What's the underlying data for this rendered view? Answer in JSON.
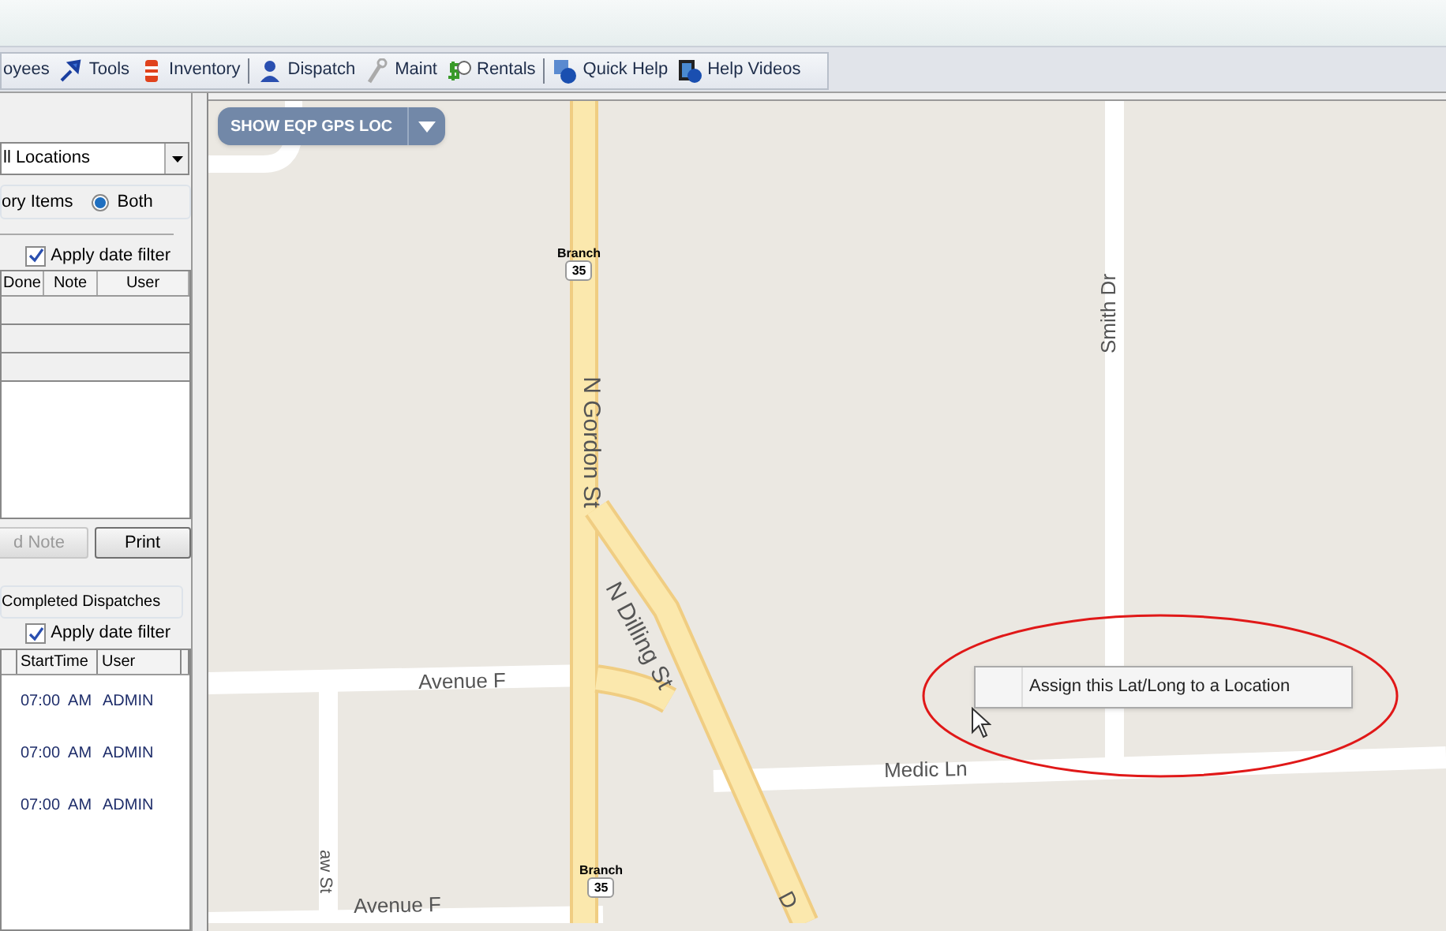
{
  "toolbar": {
    "items": [
      {
        "label": "oyees",
        "separator_before": false
      },
      {
        "label": "Tools",
        "separator_before": false
      },
      {
        "label": "Inventory",
        "separator_before": false
      },
      {
        "label": "Dispatch",
        "separator_before": true
      },
      {
        "label": "Maint",
        "separator_before": false
      },
      {
        "label": "Rentals",
        "separator_before": false
      },
      {
        "label": "Quick Help",
        "separator_before": true
      },
      {
        "label": "Help Videos",
        "separator_before": false
      }
    ]
  },
  "left_panel": {
    "location_select": {
      "value": "ll Locations"
    },
    "item_filter": [
      {
        "label": "ory Items"
      },
      {
        "label": "Both",
        "selected": true
      }
    ],
    "notes_date_filter": {
      "label": "Apply date filter",
      "checked": true
    },
    "notes_table": {
      "columns": [
        "Done",
        "Note",
        "User"
      ]
    },
    "buttons": [
      {
        "label": "d Note",
        "disabled": true
      },
      {
        "label": "Print",
        "disabled": false
      }
    ],
    "dispatch_group": {
      "title": "Completed Dispatches"
    },
    "dispatch_date_filter": {
      "label": "Apply date filter",
      "checked": true
    },
    "dispatch_table": {
      "columns": [
        "",
        "StartTime",
        "User",
        ""
      ],
      "rows": [
        [
          "",
          "07:00  AM",
          "ADMIN"
        ],
        [
          "",
          "07:00  AM",
          "ADMIN"
        ],
        [
          "",
          "07:00  AM",
          "ADMIN"
        ]
      ]
    }
  },
  "map": {
    "gps_button": {
      "label": "SHOW EQP GPS LOC"
    },
    "streets": [
      {
        "label": "N Gordon St",
        "kind": "vertical"
      },
      {
        "label": "N Dilling St",
        "kind": "diagonal"
      },
      {
        "label": "Smith Dr",
        "kind": "vertical-up"
      },
      {
        "label": "Avenue F",
        "kind": "horizontal"
      },
      {
        "label": "Medic Ln",
        "kind": "horizontal"
      },
      {
        "label": "aw St",
        "kind": "vertical"
      },
      {
        "label": "Avenue F",
        "kind": "horizontal"
      },
      {
        "label": "D",
        "kind": "diagonal"
      }
    ],
    "route_shields": [
      {
        "name": "Branch",
        "number": "35"
      },
      {
        "name": "Branch",
        "number": "35"
      }
    ],
    "context_menu": {
      "items": [
        "Assign this Lat/Long to a Location"
      ]
    }
  }
}
